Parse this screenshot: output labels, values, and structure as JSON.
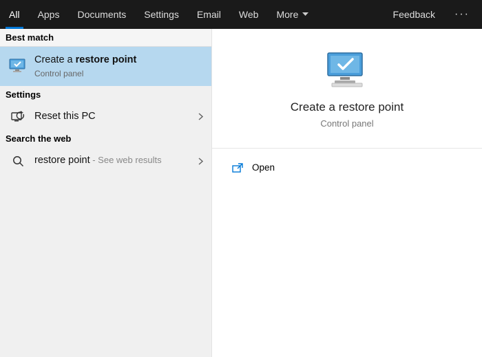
{
  "topbar": {
    "tabs": [
      {
        "label": "All",
        "active": true
      },
      {
        "label": "Apps",
        "active": false
      },
      {
        "label": "Documents",
        "active": false
      },
      {
        "label": "Settings",
        "active": false
      },
      {
        "label": "Email",
        "active": false
      },
      {
        "label": "Web",
        "active": false
      },
      {
        "label": "More",
        "active": false,
        "dropdown": true
      }
    ],
    "feedback_label": "Feedback"
  },
  "left": {
    "best_match_header": "Best match",
    "best_match": {
      "title_prefix": "Create a ",
      "title_bold": "restore point",
      "subtitle": "Control panel"
    },
    "settings_header": "Settings",
    "settings_item": {
      "title": "Reset this PC"
    },
    "search_web_header": "Search the web",
    "web_item": {
      "title": "restore point",
      "suffix": " - See web results"
    }
  },
  "right": {
    "title": "Create a restore point",
    "subtitle": "Control panel",
    "actions": {
      "open": "Open"
    }
  },
  "colors": {
    "accent": "#0078d7",
    "selected": "#b6d8ef"
  }
}
